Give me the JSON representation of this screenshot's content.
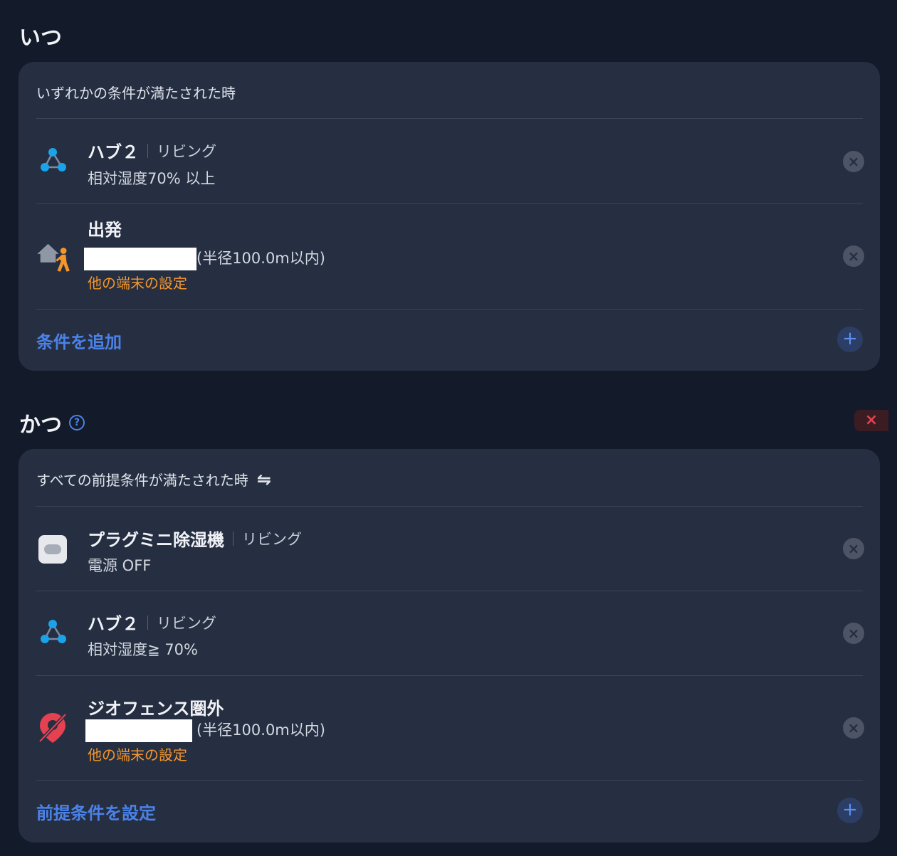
{
  "when": {
    "title": "いつ",
    "header": "いずれかの条件が満たされた時",
    "items": [
      {
        "title": "ハブ２",
        "room": "リビング",
        "sub": "相対湿度70% 以上",
        "icon": "hub-icon"
      },
      {
        "title": "出発",
        "sub": "(半径100.0m以内)",
        "warn": "他の端末の設定",
        "icon": "home-walk-icon"
      }
    ],
    "add_label": "条件を追加"
  },
  "and": {
    "title": "かつ",
    "help": "?",
    "remove": "×",
    "header": "すべての前提条件が満たされた時",
    "swap": "⇋",
    "items": [
      {
        "title": "プラグミニ除湿機",
        "room": "リビング",
        "sub": "電源 OFF",
        "icon": "plug-icon"
      },
      {
        "title": "ハブ２",
        "room": "リビング",
        "sub": "相対湿度≧ 70%",
        "icon": "hub-icon"
      },
      {
        "title": "ジオフェンス圏外",
        "sub": "(半径100.0m以内)",
        "warn": "他の端末の設定",
        "icon": "geofence-off-icon"
      }
    ],
    "add_label": "前提条件を設定"
  },
  "icons": {
    "close": "×",
    "add": "+"
  },
  "colors": {
    "accent": "#4b82e8",
    "warning": "#f5962a",
    "danger": "#e54150",
    "hub": "#1aa3e8"
  }
}
